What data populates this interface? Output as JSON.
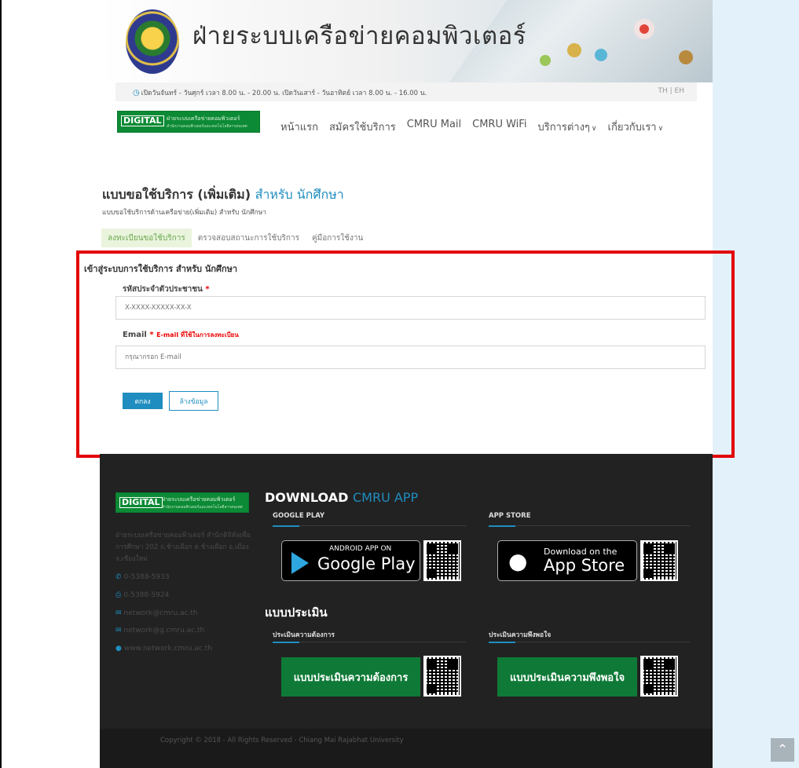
{
  "header": {
    "site_title": "ฝ่ายระบบเครือข่ายคอมพิวเตอร์",
    "hours": "เปิดวันจันทร์ - วันศุกร์ เวลา 8.00 น. - 20.00 น. เปิดวันเสาร์ - วันอาทิตย์ เวลา 8.00 น. - 16.00 น.",
    "lang": "TH  |  EH"
  },
  "logo": {
    "digital": "DIGITAL",
    "sub": "ฝ่ายระบบเครือข่ายคอมพิวเตอร์",
    "sub2": "สำนักงานคอมพิวเตอร์และเทคโนโลยีสารสนเทศ"
  },
  "nav": {
    "items": [
      "หน้าแรก",
      "สมัครใช้บริการ",
      "CMRU Mail",
      "CMRU WiFi",
      "บริการต่างๆ",
      "เกี่ยวกับเรา"
    ]
  },
  "form": {
    "title_main": "แบบขอใช้บริการ (เพิ่มเติม) ",
    "title_accent": "สำหรับ นักศึกษา",
    "subtitle": "แบบขอใช้บริการด้านเครือข่าย(เพิ่มเติม) สำหรับ นักศึกษา",
    "tabs": [
      "ลงทะเบียนขอใช้บริการ",
      "ตรวจสอบสถานะการใช้บริการ",
      "คู่มือการใช้งาน"
    ],
    "login_title": "เข้าสู่ระบบการใช้บริการ สำหรับ นักศึกษา",
    "id_label": "รหัสประจำตัวประชาชน",
    "id_required": "*",
    "id_placeholder": "X-XXXX-XXXXX-XX-X",
    "email_label": "Email",
    "email_required": "*",
    "email_note": "E-mail ที่ใช้ในการลงทะเบียน",
    "email_placeholder": "กรุณากรอก E-mail",
    "submit_label": "ตกลง",
    "clear_label": "ล้างข้อมูล"
  },
  "footer": {
    "address": "ฝ่ายระบบเครือข่ายคอมพิวเตอร์ สำนักดิจิทัลเพื่อการศึกษา 202 ถ.ช้างเผือก ต.ช้างเผือก อ.เมือง จ.เชียงใหม่",
    "phone": "0-5388-5933",
    "fax": "0-5388-5924",
    "email1": "network@cmru.ac.th",
    "email2": "network@g.cmru.ac.th",
    "website": "www.network.cmru.ac.th",
    "download_title": "DOWNLOAD",
    "download_accent": "CMRU APP",
    "google_play_label": "GOOGLE PLAY",
    "app_store_label": "APP STORE",
    "android_small": "ANDROID APP ON",
    "android_big": "Google Play",
    "apple_small": "Download on the",
    "apple_big": "App Store",
    "eval_title": "แบบประเมิน",
    "eval_need_label": "ประเมินความต้องการ",
    "eval_sat_label": "ประเมินความพึงพอใจ",
    "eval_need_button": "แบบประเมินความต้องการ",
    "eval_sat_button": "แบบประเมินความพึงพอใจ",
    "copyright": "Copyright © 2018 - All Rights Reserved - Chiang Mai Rajabhat University"
  },
  "colors": {
    "accent": "#1f8dbf",
    "brand_green": "#0c8a35",
    "highlight_red": "#e30000"
  }
}
